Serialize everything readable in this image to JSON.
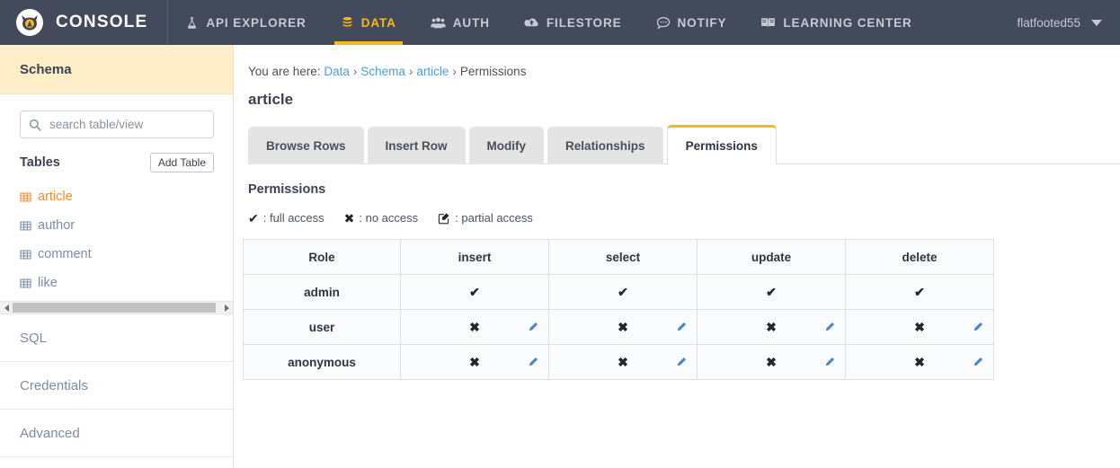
{
  "topnav": {
    "brand": "CONSOLE",
    "logo_icon": "devil-lambda-logo-icon",
    "items": [
      {
        "label": "API EXPLORER",
        "icon": "flask-icon",
        "active": false
      },
      {
        "label": "DATA",
        "icon": "database-icon",
        "active": true
      },
      {
        "label": "AUTH",
        "icon": "users-icon",
        "active": false
      },
      {
        "label": "FILESTORE",
        "icon": "cloud-upload-icon",
        "active": false
      },
      {
        "label": "NOTIFY",
        "icon": "comment-icon",
        "active": false
      },
      {
        "label": "LEARNING CENTER",
        "icon": "book-icon",
        "active": false
      }
    ],
    "user": "flatfooted55",
    "user_caret_icon": "chevron-down-icon",
    "bg_color": "#434a5c",
    "accent_color": "#f7b917"
  },
  "sidebar": {
    "header_title": "Schema",
    "header_bg": "#fdeec8",
    "search": {
      "placeholder": "search table/view",
      "value": "",
      "icon": "search-icon"
    },
    "tables_label": "Tables",
    "add_table_label": "Add Table",
    "tables": [
      {
        "name": "article",
        "icon": "table-icon",
        "active": true
      },
      {
        "name": "author",
        "icon": "table-icon",
        "active": false
      },
      {
        "name": "comment",
        "icon": "table-icon",
        "active": false
      },
      {
        "name": "like",
        "icon": "table-icon",
        "active": false
      }
    ],
    "scrollbar": {
      "left_arrow_icon": "triangle-left-icon",
      "right_arrow_icon": "triangle-right-icon"
    },
    "nav": [
      {
        "label": "SQL"
      },
      {
        "label": "Credentials"
      },
      {
        "label": "Advanced"
      }
    ],
    "active_color": "#f08c37",
    "link_color": "#7e8ba3"
  },
  "main": {
    "breadcrumb": {
      "prefix": "You are here:",
      "items": [
        {
          "label": "Data",
          "link": true
        },
        {
          "label": "Schema",
          "link": true
        },
        {
          "label": "article",
          "link": true
        },
        {
          "label": "Permissions",
          "link": false
        }
      ],
      "separator": "›"
    },
    "page_title": "article",
    "tabs": [
      {
        "label": "Browse Rows",
        "active": false
      },
      {
        "label": "Insert Row",
        "active": false
      },
      {
        "label": "Modify",
        "active": false
      },
      {
        "label": "Relationships",
        "active": false
      },
      {
        "label": "Permissions",
        "active": true
      }
    ],
    "section_title": "Permissions",
    "legend": [
      {
        "glyph": "✔",
        "icon": "check-icon",
        "text": ": full access"
      },
      {
        "glyph": "✖",
        "icon": "cross-icon",
        "text": ": no access"
      },
      {
        "glyph": "pencil-square",
        "icon": "pencil-square-icon",
        "text": ": partial access"
      }
    ],
    "table": {
      "columns": [
        "Role",
        "insert",
        "select",
        "update",
        "delete"
      ],
      "rows": [
        {
          "role": "admin",
          "cells": [
            {
              "state": "full",
              "glyph": "✔",
              "icon": "check-icon",
              "editable": false
            },
            {
              "state": "full",
              "glyph": "✔",
              "icon": "check-icon",
              "editable": false
            },
            {
              "state": "full",
              "glyph": "✔",
              "icon": "check-icon",
              "editable": false
            },
            {
              "state": "full",
              "glyph": "✔",
              "icon": "check-icon",
              "editable": false
            }
          ]
        },
        {
          "role": "user",
          "cells": [
            {
              "state": "none",
              "glyph": "✖",
              "icon": "cross-icon",
              "editable": true
            },
            {
              "state": "none",
              "glyph": "✖",
              "icon": "cross-icon",
              "editable": true
            },
            {
              "state": "none",
              "glyph": "✖",
              "icon": "cross-icon",
              "editable": true
            },
            {
              "state": "none",
              "glyph": "✖",
              "icon": "cross-icon",
              "editable": true
            }
          ]
        },
        {
          "role": "anonymous",
          "cells": [
            {
              "state": "none",
              "glyph": "✖",
              "icon": "cross-icon",
              "editable": true
            },
            {
              "state": "none",
              "glyph": "✖",
              "icon": "cross-icon",
              "editable": true
            },
            {
              "state": "none",
              "glyph": "✖",
              "icon": "cross-icon",
              "editable": true
            },
            {
              "state": "none",
              "glyph": "✖",
              "icon": "cross-icon",
              "editable": true
            }
          ]
        }
      ],
      "edit_icon": "pencil-icon",
      "edit_icon_color": "#4a86c8"
    }
  }
}
